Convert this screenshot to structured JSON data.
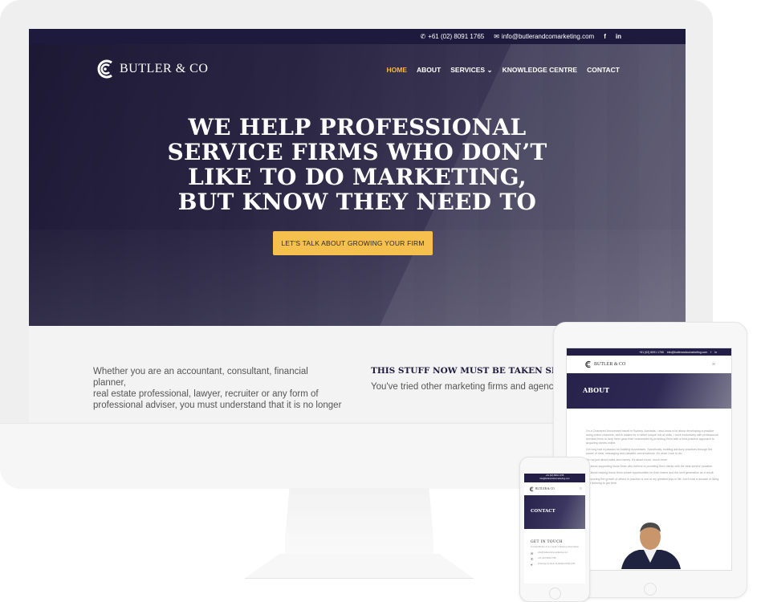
{
  "desktop": {
    "topbar": {
      "phone_icon": "phone-icon",
      "phone": "+61 (02) 8091 1765",
      "email_icon": "envelope-icon",
      "email": "info@butlerandcomarketing.com",
      "social": [
        "f",
        "in"
      ]
    },
    "brand": {
      "name": "BUTLER & CO"
    },
    "nav": {
      "items": [
        {
          "label": "HOME",
          "active": true
        },
        {
          "label": "ABOUT"
        },
        {
          "label": "SERVICES ⌄"
        },
        {
          "label": "KNOWLEDGE CENTRE"
        },
        {
          "label": "CONTACT"
        }
      ]
    },
    "hero": {
      "headline_lines": [
        "WE HELP PROFESSIONAL",
        "SERVICE FIRMS WHO DON’T",
        "LIKE TO DO MARKETING,",
        "BUT KNOW THEY NEED TO"
      ],
      "cta_label": "LET'S TALK ABOUT GROWING YOUR FIRM"
    },
    "content": {
      "intro_lines": [
        "Whether you are an accountant, consultant, financial planner,",
        "real estate professional, lawyer, recruiter or any form of",
        "professional adviser, you must understand that it is no longer"
      ],
      "section_title": "THIS STUFF NOW MUST BE TAKEN SER",
      "section_text": "You've tried other marketing firms and agencie"
    }
  },
  "tablet": {
    "topbar": {
      "phone": "+61 (02) 8091 1765",
      "email": "info@butlerandcomarketing.com",
      "social": [
        "f",
        "in"
      ]
    },
    "brand": "BUTLER & CO",
    "menu_icon": "hamburger-icon",
    "hero_title": "ABOUT",
    "paragraphs": [
      "I'm a Chartered Accountant based in Sydney, Australia. I also know a lot about developing a practice using online channels, which makes for a rather unique mix of skills. I work exclusively with professional services firms to help them grow their businesses by providing them with a best-practice approach to acquiring clients online.",
      "I've long had a passion for building businesses. Specifically, building advisory practices through the power of clear messaging and valuable conversations. It's what I love to do.",
      "It's not just about sales and money. It's about much, much more.",
      "It's about supporting those firms who believe in providing their clients with the best service possible.",
      "It's about helping those firms create opportunities for their teams and the next generation as a result.",
      "Supporting the growth of others in practice is one of my greatest joys in life, but it took a decade of living and learning to get here."
    ]
  },
  "phone": {
    "topbar": {
      "phone": "+61 (02) 8091 1765",
      "email": "info@butlerandcomarketing.com"
    },
    "brand": "BUTLER & CO",
    "menu_icon": "hamburger-icon",
    "hero_title": "CONTACT",
    "section_title": "GET IN TOUCH",
    "section_text": "Contact Butler & Co via the following information.",
    "contacts": [
      {
        "icon": "envelope-icon",
        "glyph": "✉",
        "text": "info@butlerandcomarketing.com"
      },
      {
        "icon": "phone-icon",
        "glyph": "✆",
        "text": "+61 (02) 8091 1765"
      },
      {
        "icon": "location-pin-icon",
        "glyph": "⌖",
        "text": "8 George St North Strathfield NSW 2137"
      }
    ]
  },
  "colors": {
    "brand_navy": "#1e1a3d",
    "accent_gold": "#f6c04f",
    "nav_active": "#f4b84a"
  }
}
